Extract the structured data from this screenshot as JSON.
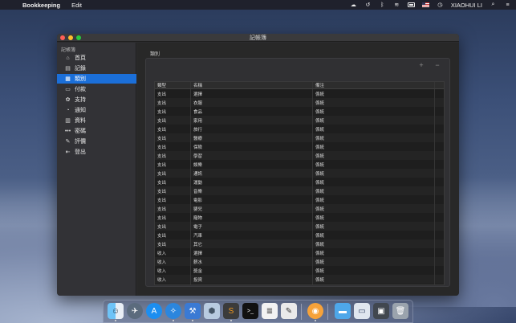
{
  "menubar": {
    "app": "Bookkeeping",
    "menus": [
      "Edit"
    ],
    "user": "XIAOHUI LI"
  },
  "window": {
    "title": "記帳簿"
  },
  "sidebar": {
    "header": "記帳簿",
    "items": [
      {
        "label": "首頁",
        "icon": "home-icon"
      },
      {
        "label": "記錄",
        "icon": "notes-icon"
      },
      {
        "label": "類別",
        "icon": "category-icon",
        "active": true
      },
      {
        "label": "付款",
        "icon": "payment-icon"
      },
      {
        "label": "支持",
        "icon": "support-icon"
      },
      {
        "label": "通知",
        "icon": "bell-icon"
      },
      {
        "label": "資料",
        "icon": "data-icon"
      },
      {
        "label": "密碼",
        "icon": "password-icon"
      },
      {
        "label": "評價",
        "icon": "rating-icon"
      },
      {
        "label": "登出",
        "icon": "logout-icon"
      }
    ]
  },
  "main": {
    "section_label": "類別",
    "add_label": "+",
    "remove_label": "−",
    "columns": [
      "類型",
      "名稱",
      "備注"
    ],
    "rows": [
      [
        "支出",
        "選擇",
        "係統"
      ],
      [
        "支出",
        "衣服",
        "係統"
      ],
      [
        "支出",
        "食品",
        "係統"
      ],
      [
        "支出",
        "家用",
        "係統"
      ],
      [
        "支出",
        "旅行",
        "係統"
      ],
      [
        "支出",
        "醫療",
        "係統"
      ],
      [
        "支出",
        "保險",
        "係統"
      ],
      [
        "支出",
        "學習",
        "係統"
      ],
      [
        "支出",
        "娛樂",
        "係統"
      ],
      [
        "支出",
        "通訊",
        "係統"
      ],
      [
        "支出",
        "運動",
        "係統"
      ],
      [
        "支出",
        "音樂",
        "係統"
      ],
      [
        "支出",
        "電影",
        "係統"
      ],
      [
        "支出",
        "嬰兒",
        "係統"
      ],
      [
        "支出",
        "寵物",
        "係統"
      ],
      [
        "支出",
        "電子",
        "係統"
      ],
      [
        "支出",
        "汽車",
        "係統"
      ],
      [
        "支出",
        "其它",
        "係統"
      ],
      [
        "收入",
        "選擇",
        "係統"
      ],
      [
        "收入",
        "薪水",
        "係統"
      ],
      [
        "收入",
        "獎金",
        "係統"
      ],
      [
        "收入",
        "投資",
        "係統"
      ],
      [
        "收入",
        "其它",
        "係統"
      ]
    ]
  },
  "dock": {
    "icons": [
      "finder-icon",
      "launchpad-icon",
      "app-store-icon",
      "safari-icon",
      "xcode-icon",
      "box-icon",
      "sublime-icon",
      "terminal-icon",
      "notes-icon",
      "textedit-icon",
      "bookkeeping-icon",
      "folder-icon",
      "preview-icon",
      "screen-icon",
      "trash-icon"
    ]
  }
}
